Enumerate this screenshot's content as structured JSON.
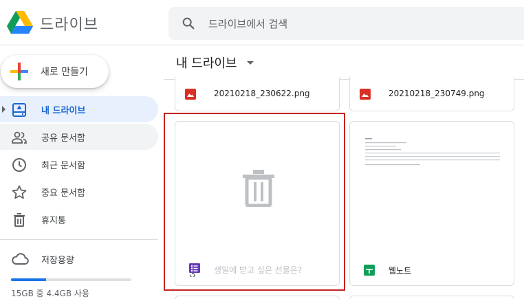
{
  "header": {
    "app_name": "드라이브",
    "search_placeholder": "드라이브에서 검색"
  },
  "sidebar": {
    "new_button_label": "새로 만들기",
    "items": [
      {
        "label": "내 드라이브",
        "icon": "my-drive-icon",
        "active": true
      },
      {
        "label": "공유 문서함",
        "icon": "shared-icon"
      },
      {
        "label": "최근 문서함",
        "icon": "clock-icon"
      },
      {
        "label": "중요 문서함",
        "icon": "star-icon"
      },
      {
        "label": "휴지통",
        "icon": "trash-icon"
      }
    ],
    "storage": {
      "label": "저장용량",
      "usage_text": "15GB 중 4.4GB 사용",
      "used_fraction": 0.29
    }
  },
  "main": {
    "title": "내 드라이브",
    "files": [
      {
        "name": "20210218_230622.png",
        "icon": "image-file-icon"
      },
      {
        "name": "20210218_230749.png",
        "icon": "image-file-icon"
      },
      {
        "name": "생일에 받고 싶은 선물은?",
        "icon": "forms-icon",
        "state": "deleting"
      },
      {
        "name": "웹노트",
        "icon": "sheets-icon"
      }
    ]
  },
  "colors": {
    "accent": "#1a73e8",
    "active_bg": "#e8f0fe",
    "selection": "#c5221f",
    "image_icon": "#d93025",
    "forms_icon": "#673ab7",
    "sheets_icon": "#0f9d58"
  }
}
